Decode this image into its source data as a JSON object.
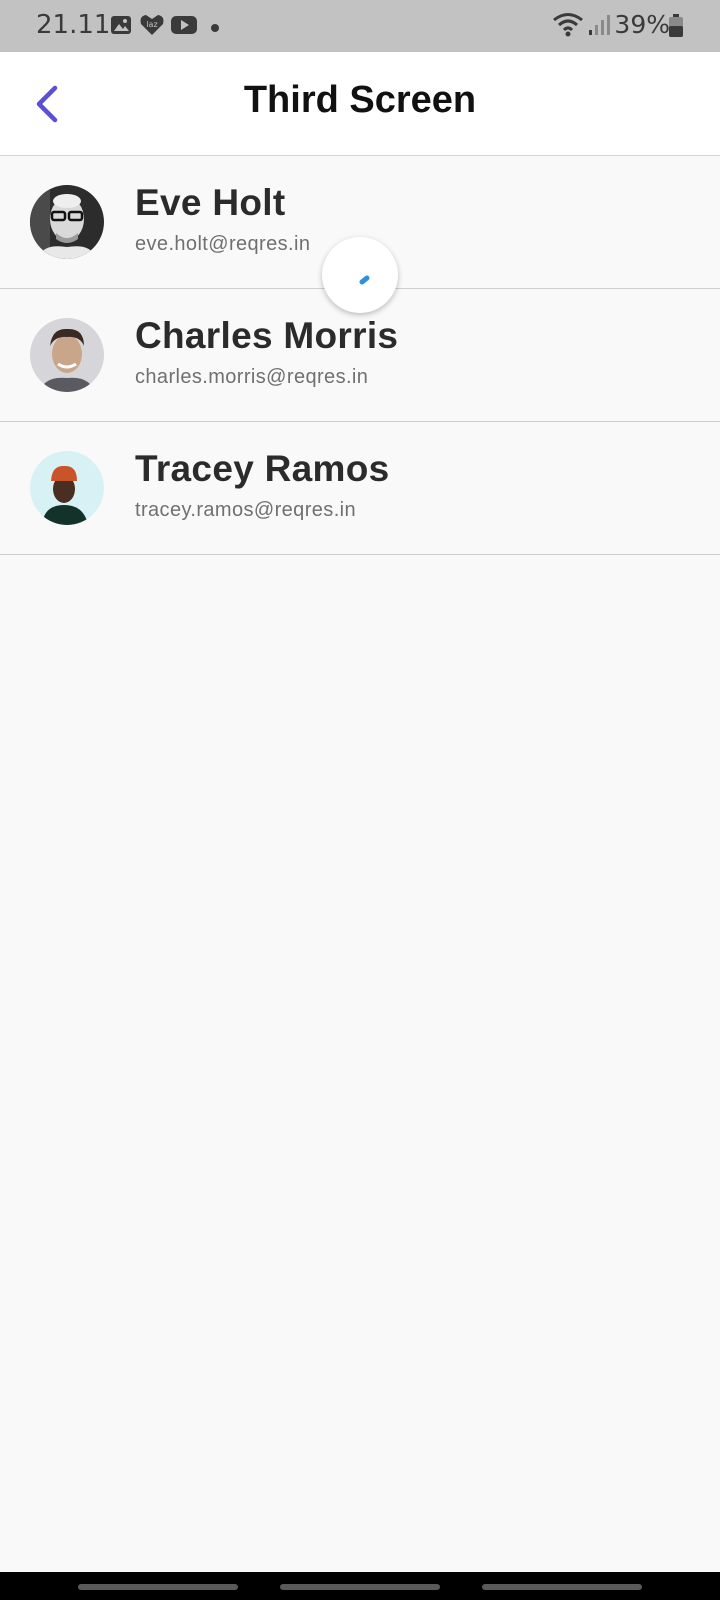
{
  "status_bar": {
    "time": "21.11",
    "battery": "39%",
    "icons": [
      "gallery-icon",
      "lazada-icon",
      "youtube-icon",
      "notification-dot-icon",
      "wifi-icon",
      "signal-icon",
      "battery-icon"
    ]
  },
  "header": {
    "title": "Third Screen",
    "back_icon": "chevron-left-icon"
  },
  "users": [
    {
      "name": "Eve Holt",
      "email": "eve.holt@reqres.in"
    },
    {
      "name": "Charles Morris",
      "email": "charles.morris@reqres.in"
    },
    {
      "name": "Tracey Ramos",
      "email": "tracey.ramos@reqres.in"
    }
  ],
  "colors": {
    "accent": "#5b4fd6",
    "spinner": "#2f8fe0",
    "background": "#f9f9f9"
  }
}
